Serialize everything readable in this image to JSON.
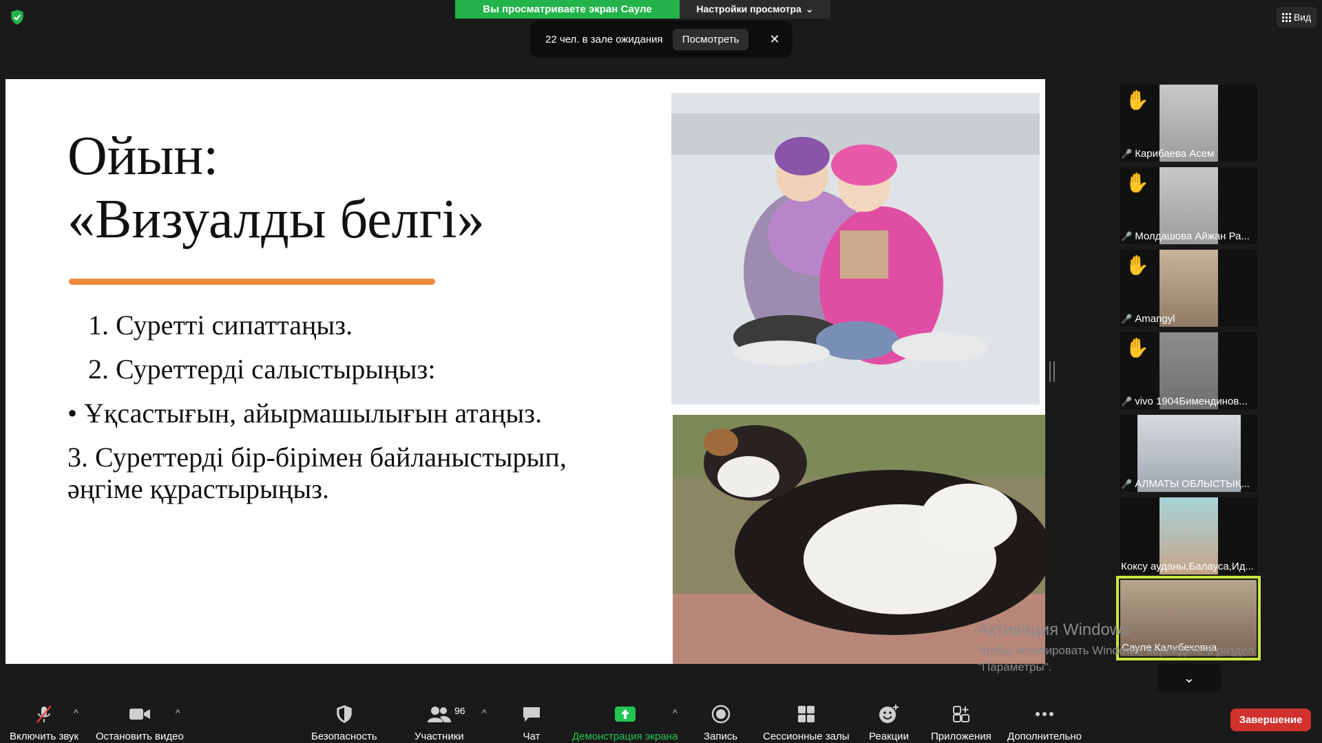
{
  "top": {
    "share_banner": "Вы просматриваете экран Сауле Калибековна",
    "view_options": "Настройки просмотра",
    "waiting_text": "22 чел. в зале ожидания",
    "view_button": "Посмотреть",
    "close": "✕",
    "view_label": "Вид"
  },
  "slide": {
    "title_line1": "Ойын:",
    "title_line2": "«Визуалды белгі»",
    "items": [
      "1. Суретті сипаттаңыз.",
      "2. Суреттерді салыстырыңыз:",
      "• Ұқсастығын, айырмашылығын атаңыз.",
      "3. Суреттерді бір-бірімен байланыстырып,",
      "әңгіме құрастырыңыз."
    ]
  },
  "participants": [
    {
      "name": "Карибаева Асем",
      "hand": true,
      "muted": true
    },
    {
      "name": "Молдашова Айжан Ра...",
      "hand": true,
      "muted": true
    },
    {
      "name": "Amangyl",
      "hand": true,
      "muted": true
    },
    {
      "name": "vivo 1904Бимендинов...",
      "hand": true,
      "muted": true
    },
    {
      "name": "АЛМАТЫ ОБЛЫСТЫҚ...",
      "hand": false,
      "muted": true
    },
    {
      "name": "Коксу ауданы,Балауса,Ид...",
      "hand": false,
      "muted": false
    },
    {
      "name": "Сауле Калибековна",
      "hand": false,
      "muted": false
    }
  ],
  "watermark": {
    "title": "Активация Windows",
    "sub": "Чтобы активировать Windows, перейдите в раздел \"Параметры\"."
  },
  "toolbar": {
    "unmute": "Включить звук",
    "stop_video": "Остановить видео",
    "security": "Безопасность",
    "participants": "Участники",
    "participants_count": "96",
    "chat": "Чат",
    "share": "Демонстрация экрана",
    "record": "Запись",
    "breakout": "Сессионные залы",
    "reactions": "Реакции",
    "apps": "Приложения",
    "more": "Дополнительно",
    "end": "Завершение"
  },
  "colors": {
    "accent_green": "#23b34a",
    "underline_orange": "#ef8a3c",
    "end_red": "#d0312d",
    "active_speaker": "#c7e843"
  }
}
